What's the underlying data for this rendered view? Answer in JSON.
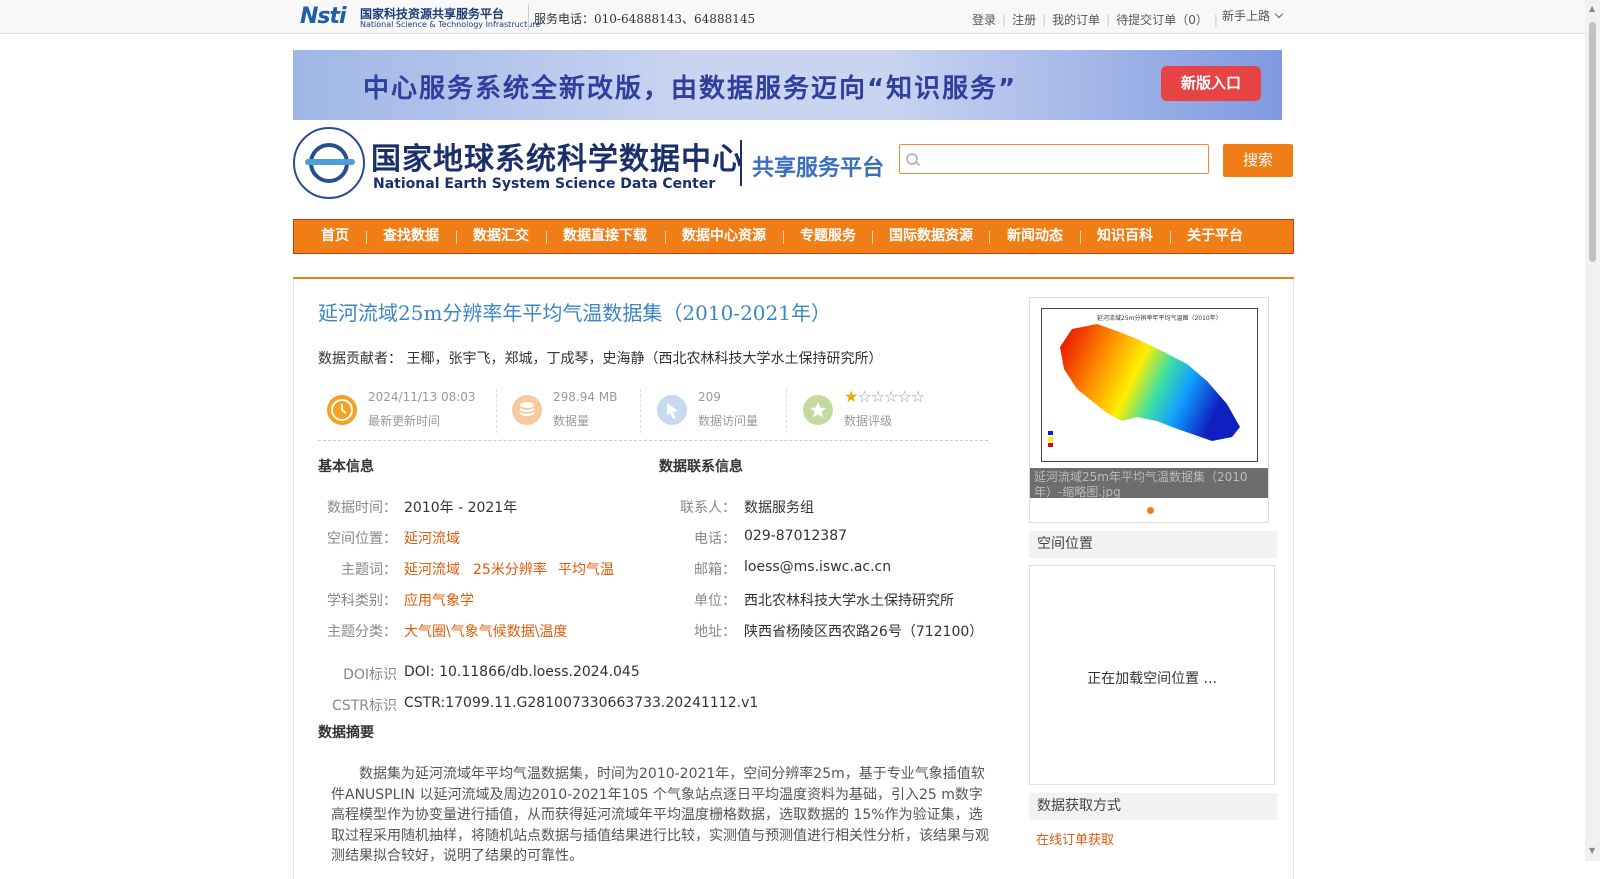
{
  "top_bar": {
    "logo_mark": "Nsti",
    "logo_cn": "国家科技资源共享服务平台",
    "logo_en": "National Science & Technology Infrastructure",
    "service_phone": "服务电话：010-64888143、64888145",
    "links": [
      "登录",
      "注册",
      "我的订单",
      "待提交订单（0）"
    ],
    "newbie_label": "新手上路"
  },
  "banner": {
    "text": "中心服务系统全新改版，由数据服务迈向“知识服务”",
    "button_label": "新版入口"
  },
  "header": {
    "center_name_cn": "国家地球系统科学数据中心",
    "center_name_en": "National Earth System Science Data Center",
    "platform_label": "共享服务平台",
    "search_placeholder": "",
    "search_button": "搜索"
  },
  "nav": {
    "items": [
      "首页",
      "查找数据",
      "数据汇交",
      "数据直接下载",
      "数据中心资源",
      "专题服务",
      "国际数据资源",
      "新闻动态",
      "知识百科",
      "关于平台"
    ]
  },
  "dataset": {
    "title": "延河流域25m分辨率年平均气温数据集（2010-2021年）",
    "contributors_label": "数据贡献者：",
    "contributors": "王椰，张宇飞，郑城，丁成琴，史海静（西北农林科技大学水土保持研究所）",
    "stats": {
      "updated": {
        "value": "2024/11/13 08:03",
        "label": "最新更新时间",
        "icon": "clock-icon"
      },
      "size": {
        "value": "298.94 MB",
        "label": "数据量",
        "icon": "database-icon"
      },
      "visits": {
        "value": "209",
        "label": "数据访问量",
        "icon": "cursor-icon"
      },
      "rating": {
        "stars_filled": 1,
        "stars_total": 6,
        "label": "数据评级",
        "icon": "star-badge-icon"
      }
    }
  },
  "basic_info": {
    "heading": "基本信息",
    "time_label": "数据时间：",
    "time_value": "2010年 - 2021年",
    "location_label": "空间位置：",
    "location_value": "延河流域",
    "keywords_label": "主题词：",
    "keywords": [
      "延河流域",
      "25米分辨率",
      "平均气温"
    ],
    "discipline_label": "学科类别：",
    "discipline_value": "应用气象学",
    "category_label": "主题分类：",
    "category_value": "大气圈\\气象气候数据\\温度",
    "doi_label": "DOI标识",
    "doi_value": "DOI: 10.11866/db.loess.2024.045",
    "cstr_label": "CSTR标识",
    "cstr_value": "CSTR:17099.11.G281007330663733.20241112.v1"
  },
  "contact_info": {
    "heading": "数据联系信息",
    "contact_label": "联系人：",
    "contact_value": "数据服务组",
    "phone_label": "电话：",
    "phone_value": "029-87012387",
    "email_label": "邮箱：",
    "email_value": "loess@ms.iswc.ac.cn",
    "unit_label": "单位：",
    "unit_value": "西北农林科技大学水土保持研究所",
    "address_label": "地址：",
    "address_value": "陕西省杨陵区西农路26号（712100）"
  },
  "abstract": {
    "heading": "数据摘要",
    "text": "数据集为延河流域年平均气温数据集，时间为2010-2021年，空间分辨率25m，基于专业气象插值软件ANUSPLIN 以延河流域及周边2010-2021年105 个气象站点逐日平均温度资料为基础，引入25 m数字高程模型作为协变量进行插值，从而获得延河流域年平均温度栅格数据，选取数据的 15%作为验证集，选取过程采用随机抽样，将随机站点数据与插值结果进行比较，实测值与预测值进行相关性分析，该结果与观测结果拟合较好，说明了结果的可靠性。"
  },
  "sidebar": {
    "thumb_map_title": "延河流域25m分辨率年平均气温图（2010年）",
    "thumb_caption": "延河流域25m年平均气温数据集（2010年）-缩略图.jpg",
    "spatial_heading": "空间位置",
    "map_loading": "正在加载空间位置 ...",
    "access_heading": "数据获取方式",
    "access_link": "在线订单获取"
  },
  "colors": {
    "accent_orange": "#f07e16",
    "nav_border": "#c9371a",
    "title_blue": "#3b86c6",
    "link_orange": "#e05a0b"
  }
}
